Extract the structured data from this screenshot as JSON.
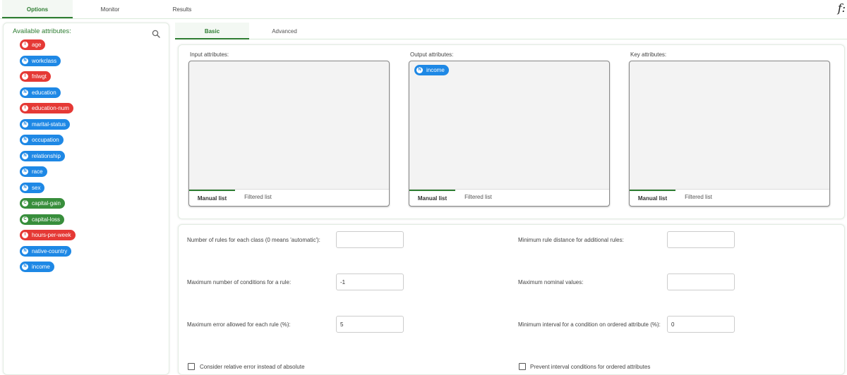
{
  "top_tabs": [
    "Options",
    "Monitor",
    "Results"
  ],
  "fx_label": "f:",
  "left": {
    "title": "Available attributes:",
    "attributes": [
      {
        "type": "I",
        "name": "age"
      },
      {
        "type": "N",
        "name": "workclass"
      },
      {
        "type": "I",
        "name": "fnlwgt"
      },
      {
        "type": "N",
        "name": "education"
      },
      {
        "type": "I",
        "name": "education-num"
      },
      {
        "type": "N",
        "name": "marital-status"
      },
      {
        "type": "N",
        "name": "occupation"
      },
      {
        "type": "N",
        "name": "relationship"
      },
      {
        "type": "N",
        "name": "race"
      },
      {
        "type": "N",
        "name": "sex"
      },
      {
        "type": "C",
        "name": "capital-gain"
      },
      {
        "type": "C",
        "name": "capital-loss"
      },
      {
        "type": "I",
        "name": "hours-per-week"
      },
      {
        "type": "N",
        "name": "native-country"
      },
      {
        "type": "N",
        "name": "income"
      }
    ]
  },
  "sub_tabs": [
    "Basic",
    "Advanced"
  ],
  "boxes": {
    "input_label": "Input attributes:",
    "output_label": "Output attributes:",
    "key_label": "Key attributes:",
    "output_items": [
      {
        "type": "N",
        "name": "income"
      }
    ],
    "manual_tab": "Manual list",
    "filtered_tab": "Filtered list"
  },
  "fields": {
    "rules_per_class": {
      "label": "Number of rules for each class (0 means 'automatic'):",
      "value": ""
    },
    "min_rule_distance": {
      "label": "Minimum rule distance for additional rules:",
      "value": ""
    },
    "max_conditions": {
      "label": "Maximum number of conditions for a rule:",
      "value": "-1"
    },
    "max_nominal": {
      "label": "Maximum nominal values:",
      "value": ""
    },
    "max_error": {
      "label": "Maximum error allowed for each rule (%):",
      "value": "5"
    },
    "min_interval": {
      "label": "Minimum interval for a condition on ordered attribute (%):",
      "value": "0"
    }
  },
  "checkboxes": {
    "relative_error": "Consider relative error instead of absolute",
    "prevent_interval": "Prevent interval conditions for ordered attributes"
  },
  "colors": {
    "accent": "#2e7d32",
    "integer": "#e53935",
    "nominal": "#1e88e5",
    "continuous": "#388e3c"
  }
}
